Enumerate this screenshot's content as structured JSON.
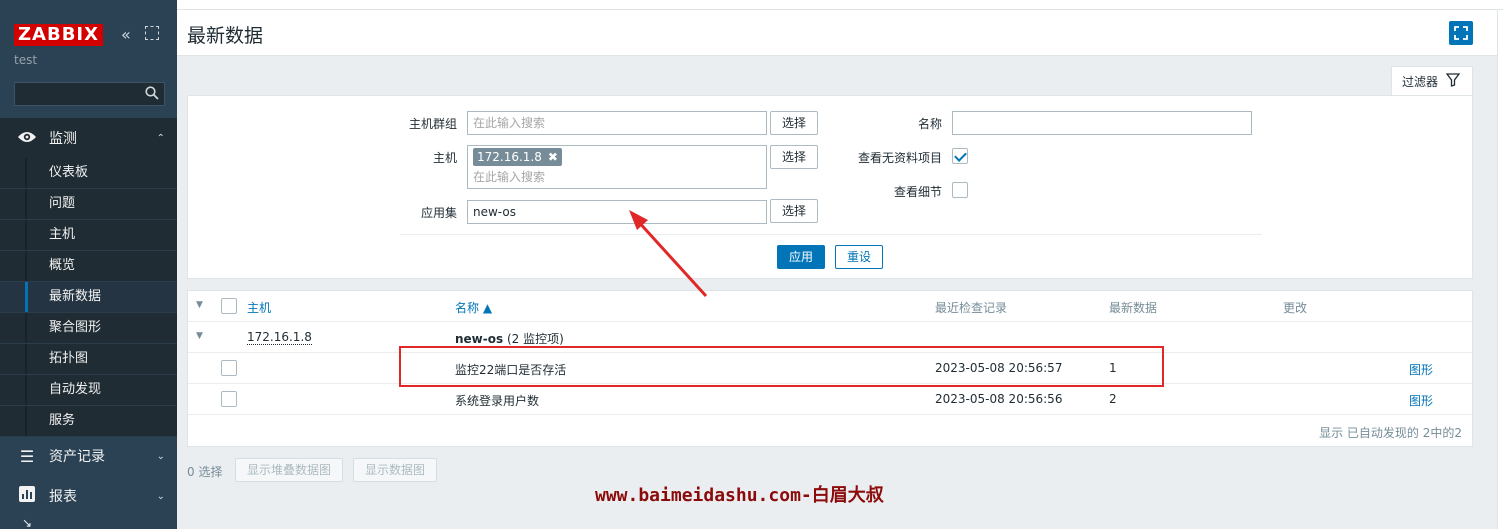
{
  "sidebar": {
    "logo": "ZABBIX",
    "server_name": "test",
    "search_placeholder": "",
    "sections": {
      "monitoring": "监测",
      "assets": "资产记录",
      "reports": "报表"
    },
    "monitoring_items": [
      "仪表板",
      "问题",
      "主机",
      "概览",
      "最新数据",
      "聚合图形",
      "拓扑图",
      "自动发现",
      "服务"
    ],
    "active_item": "最新数据"
  },
  "header": {
    "title": "最新数据"
  },
  "filter": {
    "tab_label": "过滤器",
    "host_group_label": "主机群组",
    "host_group_placeholder": "在此输入搜索",
    "host_label": "主机",
    "host_tag": "172.16.1.8",
    "host_placeholder": "在此输入搜索",
    "application_label": "应用集",
    "application_value": "new-os",
    "select_label": "选择",
    "name_label": "名称",
    "name_value": "",
    "show_without_data_label": "查看无资料项目",
    "show_without_data": true,
    "show_details_label": "查看细节",
    "show_details": false,
    "apply_label": "应用",
    "reset_label": "重设"
  },
  "table": {
    "headers": {
      "host": "主机",
      "name": "名称 ▲",
      "last_check": "最近检查记录",
      "last_value": "最新数据",
      "change": "更改"
    },
    "group": {
      "host": "172.16.1.8",
      "app_name": "new-os",
      "app_count": "(2 监控项)"
    },
    "rows": [
      {
        "name": "监控22端口是否存活",
        "last_check": "2023-05-08 20:56:57",
        "last_value": "1",
        "change": "",
        "action": "图形"
      },
      {
        "name": "系统登录用户数",
        "last_check": "2023-05-08 20:56:56",
        "last_value": "2",
        "change": "",
        "action": "图形"
      }
    ],
    "footer": "显示 已自动发现的 2中的2"
  },
  "actions": {
    "selected_count": "0 选择",
    "stacked_graph": "显示堆叠数据图",
    "graph": "显示数据图"
  },
  "watermark": "www.baimeidashu.com-白眉大叔",
  "colors": {
    "sidebar_bg": "#2b4255",
    "accent": "#0275b8",
    "logo_red": "#d40000",
    "annotation_red": "#e02828"
  }
}
